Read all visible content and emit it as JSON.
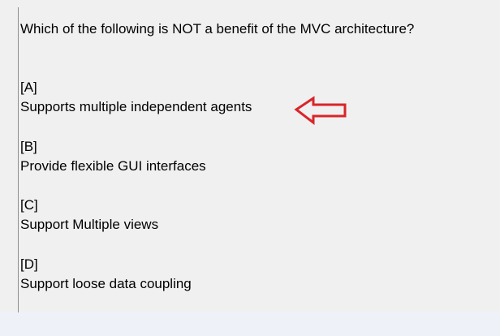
{
  "question": {
    "text": "Which of the following is NOT a benefit of the MVC architecture?"
  },
  "options": [
    {
      "letter": "[A]",
      "text": "Supports multiple independent agents"
    },
    {
      "letter": "[B]",
      "text": "Provide flexible GUI interfaces"
    },
    {
      "letter": "[C]",
      "text": "Support Multiple views"
    },
    {
      "letter": "[D]",
      "text": "Support loose data coupling"
    }
  ],
  "annotation": {
    "arrow_icon": "left-arrow-icon",
    "arrow_color": "#d9252a"
  },
  "colors": {
    "panel_background": "#f0f0f0",
    "outer_background": "#eef1f8",
    "text": "#000000",
    "rule": "#8f8f8f"
  }
}
